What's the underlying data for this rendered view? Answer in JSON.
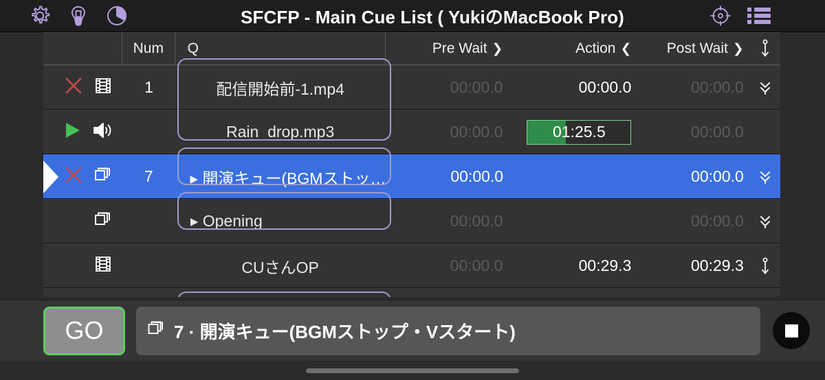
{
  "toolbar": {
    "title": "SFCFP - Main Cue List ( YukiのMacBook Pro)",
    "icons": {
      "settings": "gear-icon",
      "light": "lightbulb-icon",
      "pie": "pie-chart-icon",
      "target": "target-icon",
      "list": "list-icon"
    },
    "accent_color": "#b39ddb"
  },
  "table": {
    "headers": {
      "flags": "",
      "num": "Num",
      "q": "Q",
      "pre_wait": "Pre Wait",
      "pre_wait_arrow": "❯",
      "action": "Action",
      "action_arrow": "❮",
      "post_wait": "Post Wait",
      "post_wait_arrow": "❯",
      "continue": "anchor-icon"
    },
    "rows": [
      {
        "playing": false,
        "selected": false,
        "status_icon": "x-icon",
        "type_icon": "film-icon",
        "num": "1",
        "q": "配信開始前-1.mp4",
        "q_align": "center",
        "q_disclosure": "",
        "pre_wait": "00:00.0",
        "pre_wait_dim": true,
        "action": "00:00.0",
        "action_dim": false,
        "action_progress": null,
        "post_wait": "00:00.0",
        "post_wait_dim": true,
        "continue_icon": "double-chevron-down-icon"
      },
      {
        "playing": true,
        "selected": false,
        "status_icon": "play-icon",
        "type_icon": "speaker-icon",
        "num": "",
        "q": "Rain_drop.mp3",
        "q_align": "center",
        "q_disclosure": "",
        "pre_wait": "00:00.0",
        "pre_wait_dim": true,
        "action": "01:25.5",
        "action_dim": false,
        "action_progress": 37,
        "post_wait": "00:00.0",
        "post_wait_dim": true,
        "continue_icon": ""
      },
      {
        "playing": false,
        "selected": true,
        "status_icon": "x-icon",
        "type_icon": "group-icon",
        "num": "7",
        "q": "開演キュー(BGMストッ…",
        "q_align": "left",
        "q_disclosure": "▸",
        "pre_wait": "00:00.0",
        "pre_wait_dim": false,
        "action": "",
        "action_dim": false,
        "action_progress": null,
        "post_wait": "00:00.0",
        "post_wait_dim": false,
        "continue_icon": "double-chevron-down-icon"
      },
      {
        "playing": false,
        "selected": false,
        "status_icon": "",
        "type_icon": "group-icon",
        "num": "",
        "q": "Opening",
        "q_align": "left",
        "q_disclosure": "▸",
        "pre_wait": "00:00.0",
        "pre_wait_dim": true,
        "action": "",
        "action_dim": false,
        "action_progress": null,
        "post_wait": "00:00.0",
        "post_wait_dim": true,
        "continue_icon": "double-chevron-down-icon"
      },
      {
        "playing": false,
        "selected": false,
        "status_icon": "",
        "type_icon": "film-icon",
        "num": "",
        "q": "CUさんOP",
        "q_align": "center",
        "q_disclosure": "",
        "pre_wait": "00:00.0",
        "pre_wait_dim": true,
        "action": "00:29.3",
        "action_dim": false,
        "action_progress": null,
        "post_wait": "00:29.3",
        "post_wait_dim": false,
        "continue_icon": "anchor-icon"
      }
    ]
  },
  "transport": {
    "go_label": "GO",
    "go_border_color": "#5fcc62",
    "cue_icon": "group-icon",
    "cue_label": "7 · 開演キュー(BGMストップ・Vスタート)",
    "stop_label": "stop-icon"
  }
}
